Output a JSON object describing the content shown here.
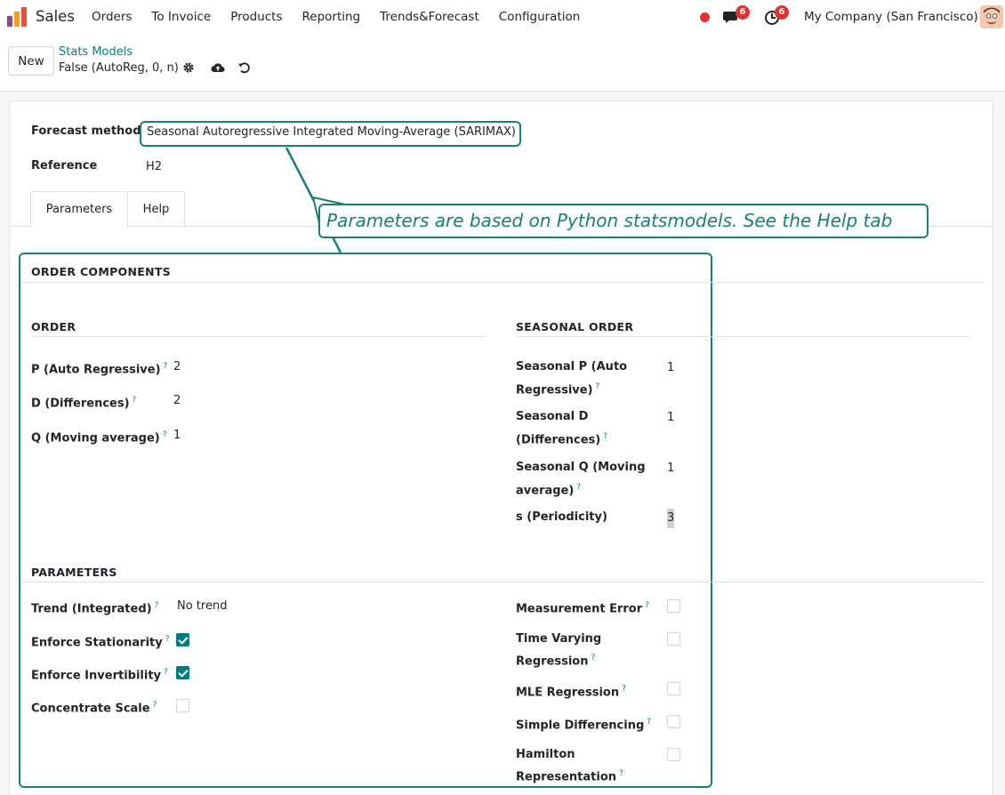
{
  "navbar": {
    "app_name": "Sales",
    "menu": [
      "Orders",
      "To Invoice",
      "Products",
      "Reporting",
      "Trends&Forecast",
      "Configuration"
    ],
    "chat_count": "6",
    "activity_count": "6",
    "company": "My Company (San Francisco)"
  },
  "control": {
    "new_label": "New",
    "breadcrumb": "Stats Models",
    "record_name": "False (AutoReg, 0, n)"
  },
  "form": {
    "forecast_method_label": "Forecast method",
    "forecast_method_value": "Seasonal Autoregressive Integrated Moving-Average (SARIMAX)",
    "reference_label": "Reference",
    "reference_value": "H2",
    "tabs": [
      "Parameters",
      "Help"
    ],
    "callout": "Parameters are based on Python statsmodels. See the Help tab",
    "order_components_title": "ORDER COMPONENTS",
    "order_title": "ORDER",
    "seasonal_order_title": "SEASONAL ORDER",
    "p_label": "P (Auto Regressive)",
    "p_value": "2",
    "d_label": "D (Differences)",
    "d_value": "2",
    "q_label": "Q (Moving average)",
    "q_value": "1",
    "sp_label_1": "Seasonal P (Auto",
    "sp_label_2": "Regressive)",
    "sp_value": "1",
    "sd_label_1": "Seasonal D",
    "sd_label_2": "(Differences)",
    "sd_value": "1",
    "sq_label_1": "Seasonal Q (Moving",
    "sq_label_2": "average)",
    "sq_value": "1",
    "s_label": "s (Periodicity)",
    "s_value": "3",
    "parameters_title": "PARAMETERS",
    "trend_label": "Trend (Integrated)",
    "trend_value": "No trend",
    "stationarity_label": "Enforce Stationarity",
    "stationarity_checked": true,
    "invertibility_label": "Enforce Invertibility",
    "invertibility_checked": true,
    "concentrate_label": "Concentrate Scale",
    "concentrate_checked": false,
    "measurement_label": "Measurement Error",
    "time_varying_label_1": "Time Varying",
    "time_varying_label_2": "Regression",
    "mle_label": "MLE Regression",
    "simple_diff_label": "Simple Differencing",
    "hamilton_label_1": "Hamilton",
    "hamilton_label_2": "Representation",
    "help_marker": "?"
  },
  "colors": {
    "accent": "#017e84",
    "annotation": "#1a7f75",
    "badge": "#e0322f"
  }
}
